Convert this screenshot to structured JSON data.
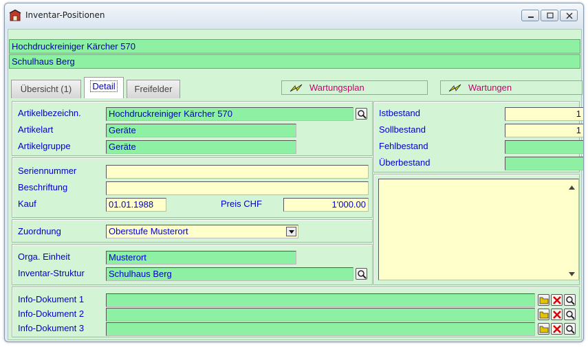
{
  "window": {
    "title": "Inventar-Positionen"
  },
  "header": {
    "artikel": "Hochdruckreiniger Kärcher 570",
    "standort": "Schulhaus Berg"
  },
  "tabs": [
    {
      "label": "Übersicht (1)"
    },
    {
      "label": "Detail"
    },
    {
      "label": "Freifelder"
    }
  ],
  "links": {
    "wartungsplan": "Wartungsplan",
    "wartungen": "Wartungen"
  },
  "artikel": {
    "bezeichnung_label": "Artikelbezeichn.",
    "bezeichnung_value": "Hochdruckreiniger Kärcher 570",
    "art_label": "Artikelart",
    "art_value": "Geräte",
    "gruppe_label": "Artikelgruppe",
    "gruppe_value": "Geräte"
  },
  "bestand": {
    "ist_label": "Istbestand",
    "ist_value": "1",
    "soll_label": "Sollbestand",
    "soll_value": "1",
    "fehl_label": "Fehlbestand",
    "fehl_value": "",
    "ueber_label": "Überbestand",
    "ueber_value": ""
  },
  "serie": {
    "nummer_label": "Seriennummer",
    "nummer_value": "",
    "beschriftung_label": "Beschriftung",
    "beschriftung_value": "",
    "kauf_label": "Kauf",
    "kauf_value": "01.01.1988",
    "preis_label": "Preis CHF",
    "preis_value": "1'000.00"
  },
  "zuordnung": {
    "label": "Zuordnung",
    "value": "Oberstufe Musterort"
  },
  "orga": {
    "einheit_label": "Orga. Einheit",
    "einheit_value": "Musterort",
    "struktur_label": "Inventar-Struktur",
    "struktur_value": "Schulhaus Berg"
  },
  "notes": {
    "value": ""
  },
  "info_docs": [
    {
      "label": "Info-Dokument 1",
      "value": ""
    },
    {
      "label": "Info-Dokument 2",
      "value": ""
    },
    {
      "label": "Info-Dokument 3",
      "value": ""
    }
  ],
  "colors": {
    "field_green": "#8ef0a2",
    "field_yellow": "#ffffcc",
    "panel_bg": "#d3f5d5",
    "label_blue": "#0000c8",
    "link_magenta": "#c8006e"
  }
}
